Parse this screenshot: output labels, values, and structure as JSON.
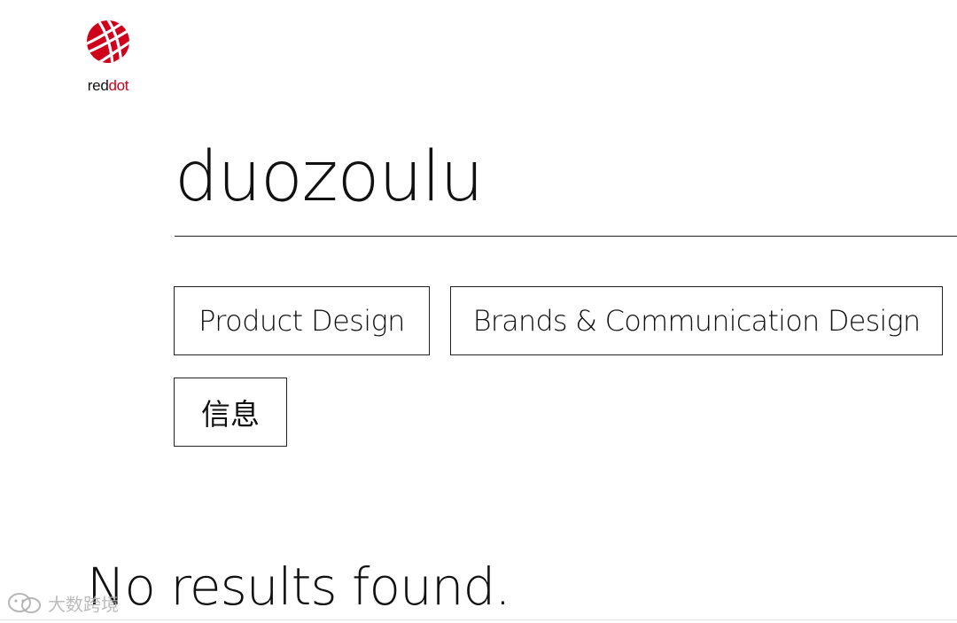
{
  "brand": {
    "logo_prefix": "red",
    "logo_suffix": "dot",
    "accent_color": "#d0021b"
  },
  "search": {
    "query": "duozoulu"
  },
  "filters": [
    {
      "label": "Product Design"
    },
    {
      "label": "Brands & Communication Design"
    },
    {
      "label": "信息"
    }
  ],
  "results": {
    "message": "No results found."
  },
  "watermark": {
    "text": "大数跨境",
    "icon": "wechat-logo-icon"
  }
}
